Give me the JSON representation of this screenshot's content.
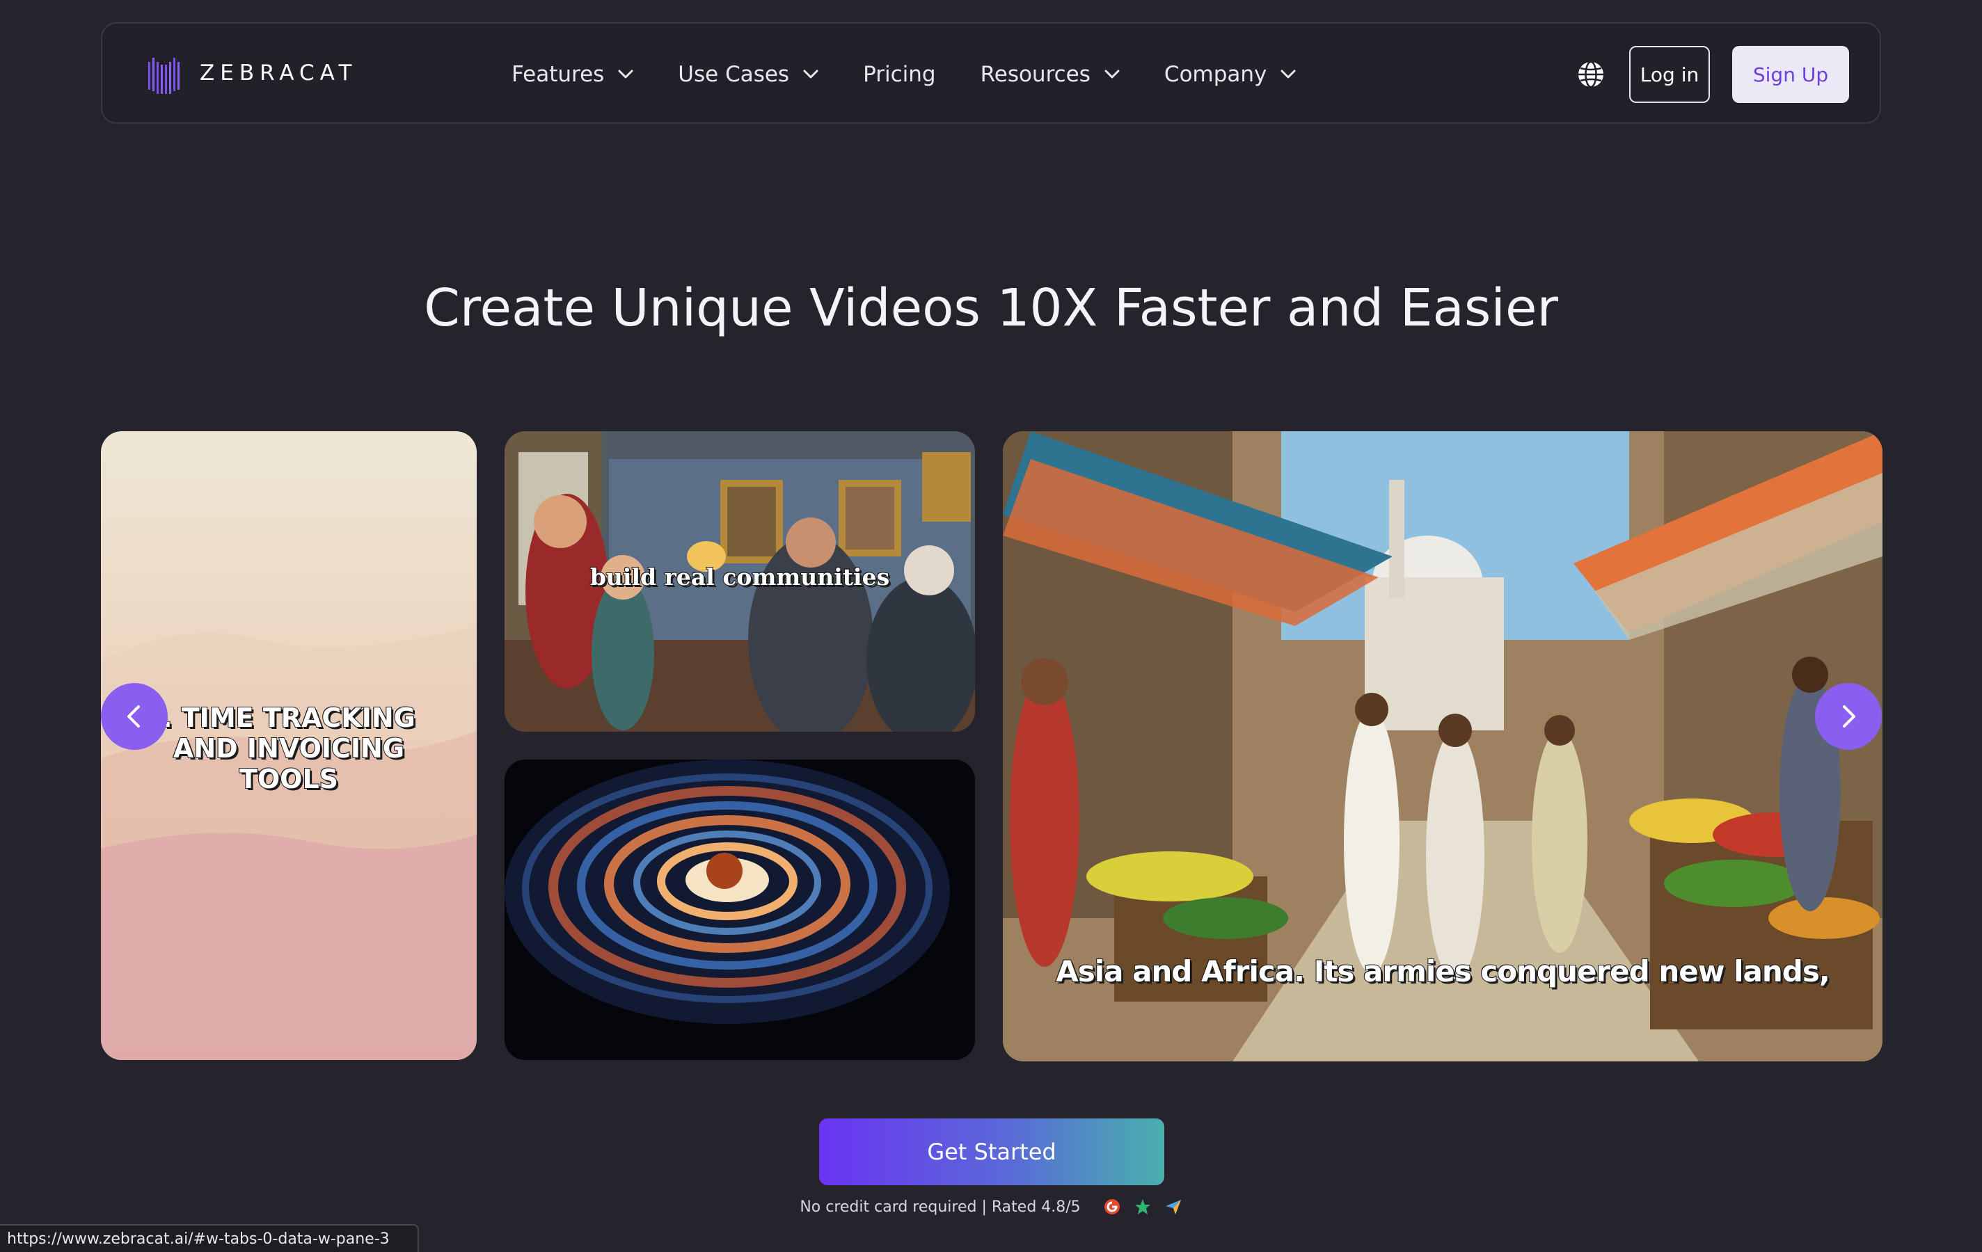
{
  "brand": {
    "name": "ZEBRACAT",
    "accent_color": "#8a5ff0"
  },
  "nav": {
    "items": [
      {
        "label": "Features",
        "has_dropdown": true
      },
      {
        "label": "Use Cases",
        "has_dropdown": true
      },
      {
        "label": "Pricing",
        "has_dropdown": false
      },
      {
        "label": "Resources",
        "has_dropdown": true
      },
      {
        "label": "Company",
        "has_dropdown": true
      }
    ],
    "language_icon": "globe-icon",
    "login_label": "Log in",
    "signup_label": "Sign Up"
  },
  "hero": {
    "title": "Create Unique Videos 10X Faster and Easier"
  },
  "carousel": {
    "cards": [
      {
        "caption": ". TIME TRACKING AND INVOICING TOOLS"
      },
      {
        "caption": "build real communities"
      },
      {
        "caption": ""
      },
      {
        "caption": "Asia and Africa. Its armies conquered new lands,"
      }
    ],
    "prev_icon": "chevron-left-icon",
    "next_icon": "chevron-right-icon"
  },
  "cta": {
    "label": "Get Started",
    "note": "No credit card required | Rated 4.8/5"
  },
  "status_bar": {
    "url": "https://www.zebracat.ai/#w-tabs-0-data-w-pane-3"
  }
}
